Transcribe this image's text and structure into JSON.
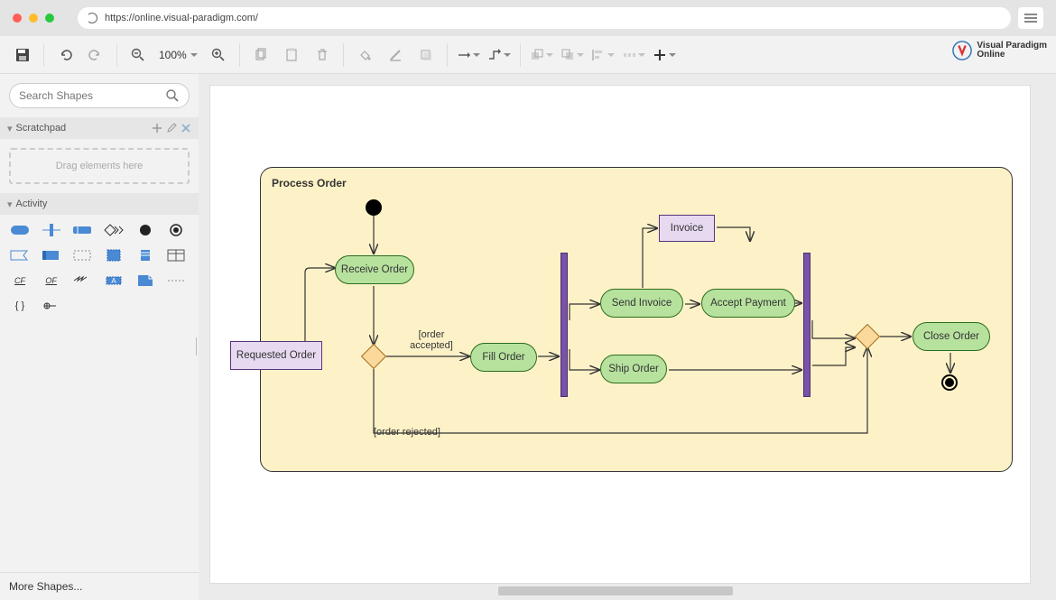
{
  "url": "https://online.visual-paradigm.com/",
  "brand": {
    "line1": "Visual Paradigm",
    "line2": "Online"
  },
  "toolbar": {
    "zoom": "100%"
  },
  "sidebar": {
    "search_placeholder": "Search Shapes",
    "scratchpad_label": "Scratchpad",
    "scratchpad_hint": "Drag elements here",
    "activity_label": "Activity",
    "more_shapes": "More Shapes..."
  },
  "diagram": {
    "frame_title": "Process Order",
    "nodes": {
      "requested_order": "Requested Order",
      "receive_order": "Receive Order",
      "fill_order": "Fill Order",
      "send_invoice": "Send Invoice",
      "invoice": "Invoice",
      "accept_payment": "Accept Payment",
      "ship_order": "Ship Order",
      "close_order": "Close Order"
    },
    "guards": {
      "accepted": "[order\naccepted]",
      "rejected": "[order rejected]"
    },
    "edges": [
      {
        "from": "initial",
        "to": "receive_order"
      },
      {
        "from": "requested_order",
        "to": "receive_order"
      },
      {
        "from": "receive_order",
        "to": "decision1"
      },
      {
        "from": "decision1",
        "to": "fill_order",
        "guard": "accepted"
      },
      {
        "from": "decision1",
        "to": "merge1",
        "guard": "rejected"
      },
      {
        "from": "fill_order",
        "to": "fork1"
      },
      {
        "from": "fork1",
        "to": "send_invoice"
      },
      {
        "from": "fork1",
        "to": "ship_order"
      },
      {
        "from": "send_invoice",
        "to": "invoice"
      },
      {
        "from": "invoice",
        "to": "accept_payment"
      },
      {
        "from": "accept_payment",
        "to": "join1"
      },
      {
        "from": "ship_order",
        "to": "join1"
      },
      {
        "from": "join1",
        "to": "merge1"
      },
      {
        "from": "merge1",
        "to": "close_order"
      },
      {
        "from": "close_order",
        "to": "final"
      }
    ]
  },
  "shape_palette": [
    "activity",
    "partition-v",
    "partition-h",
    "send-signal",
    "initial",
    "final",
    "accept-event",
    "subactivity",
    "dashed-box",
    "time-event",
    "datastore",
    "table",
    "control-flow",
    "object-flow",
    "interrupt-flow",
    "expansion",
    "note",
    "divider",
    "constraint",
    "pin"
  ]
}
